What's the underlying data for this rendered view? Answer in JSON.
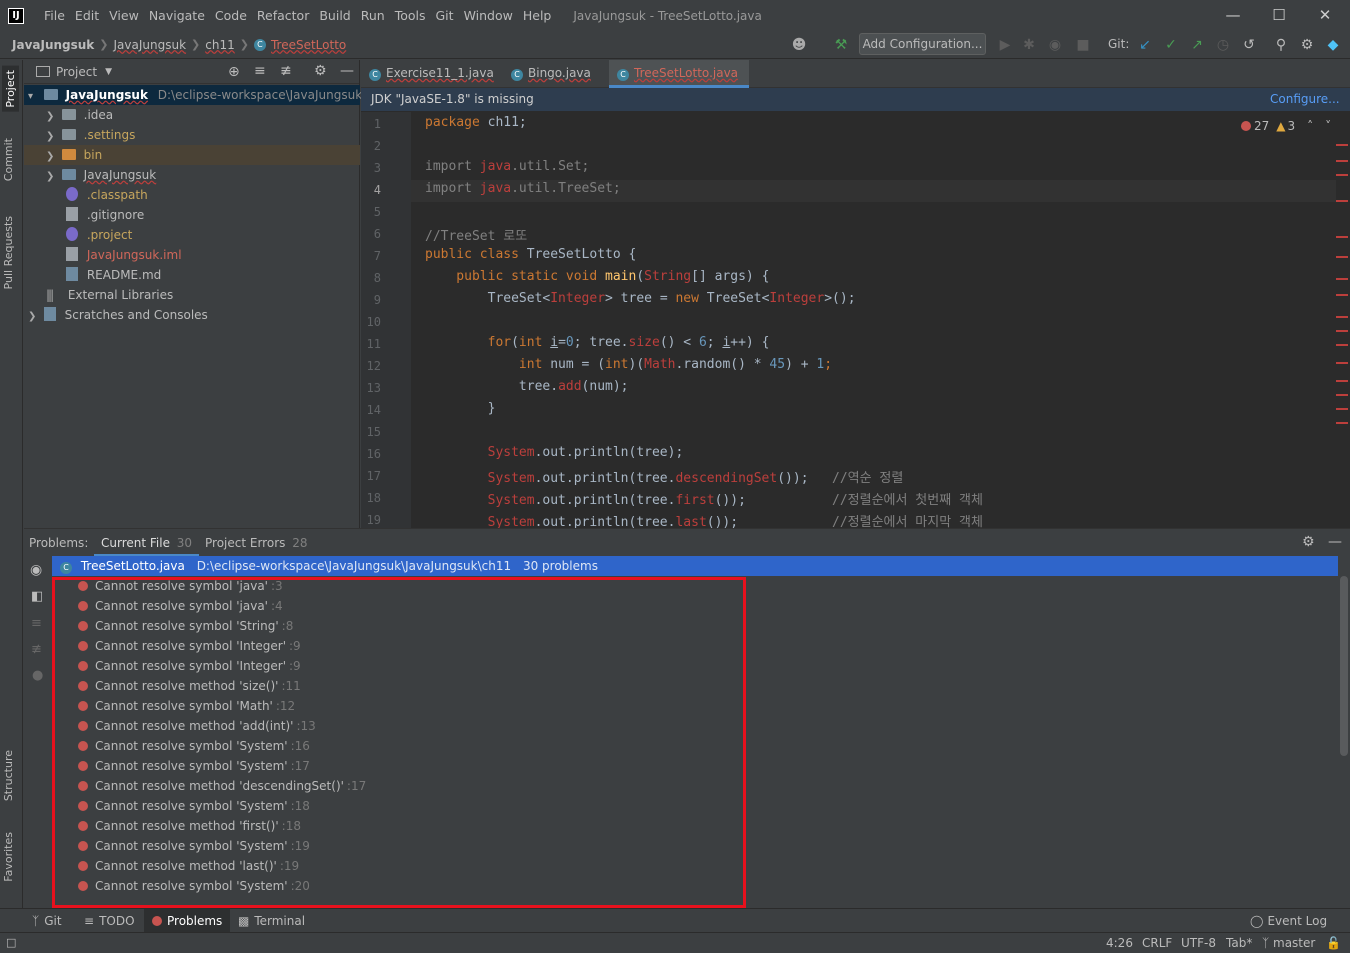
{
  "window": {
    "title": "JavaJungsuk - TreeSetLotto.java",
    "menu": [
      "File",
      "Edit",
      "View",
      "Navigate",
      "Code",
      "Refactor",
      "Build",
      "Run",
      "Tools",
      "Git",
      "Window",
      "Help"
    ],
    "logo": "IJ"
  },
  "breadcrumb": [
    "JavaJungsuk",
    "JavaJungsuk",
    "ch11",
    "TreeSetLotto"
  ],
  "toolbar": {
    "add_config": "Add Configuration...",
    "git_label": "Git:"
  },
  "left_stripe": {
    "project": "Project",
    "commit": "Commit",
    "pull_requests": "Pull Requests",
    "structure": "Structure",
    "favorites": "Favorites"
  },
  "project_panel": {
    "title": "Project",
    "root": {
      "name": "JavaJungsuk",
      "path": "D:\\eclipse-workspace\\JavaJungsuk"
    },
    "items": [
      {
        "name": ".idea",
        "type": "folder",
        "color": "#bbbbbb"
      },
      {
        "name": ".settings",
        "type": "folder",
        "color": "#c7a65d"
      },
      {
        "name": "bin",
        "type": "folder-excluded",
        "color": "#c7a65d"
      },
      {
        "name": "JavaJungsuk",
        "type": "folder",
        "color": "#bbbbbb"
      },
      {
        "name": ".classpath",
        "type": "file",
        "color": "#c7a65d"
      },
      {
        "name": ".gitignore",
        "type": "file",
        "color": "#bbbbbb"
      },
      {
        "name": ".project",
        "type": "file",
        "color": "#c7a65d"
      },
      {
        "name": "JavaJungsuk.iml",
        "type": "file",
        "color": "#d1675a"
      },
      {
        "name": "README.md",
        "type": "file",
        "color": "#bbbbbb"
      },
      {
        "name": "External Libraries",
        "type": "lib",
        "color": "#bbbbbb"
      },
      {
        "name": "Scratches and Consoles",
        "type": "scratch",
        "color": "#bbbbbb"
      }
    ]
  },
  "editor": {
    "tabs": [
      "Exercise11_1.java",
      "Bingo.java",
      "TreeSetLotto.java"
    ],
    "banner": {
      "message": "JDK \"JavaSE-1.8\" is missing",
      "action": "Configure..."
    },
    "inspection": {
      "errors": "27",
      "warnings": "3"
    },
    "line_numbers": [
      "1",
      "2",
      "3",
      "4",
      "5",
      "6",
      "7",
      "8",
      "9",
      "10",
      "11",
      "12",
      "13",
      "14",
      "15",
      "16",
      "17",
      "18",
      "19"
    ],
    "lines": {
      "l1": "package ch11;",
      "l3_a": "import ",
      "l3_b": "java",
      "l3_c": ".util.Set;",
      "l4_a": "import ",
      "l4_b": "java",
      "l4_c": ".util.TreeSet;",
      "l6": "//TreeSet 로또",
      "l7_a": "public class ",
      "l7_b": "TreeSetLotto {",
      "l8_a": "    public static void ",
      "l8_b": "main",
      "l8_c": "(",
      "l8_d": "String",
      "l8_e": "[] args) {",
      "l9_a": "        TreeSet<",
      "l9_b": "Integer",
      "l9_c": "> tree = ",
      "l9_d": "new ",
      "l9_e": "TreeSet<",
      "l9_f": "Integer",
      "l9_g": ">();",
      "l11_a": "        for",
      "l11_b": "(",
      "l11_c": "int ",
      "l11_d": "i",
      "l11_e": "=",
      "l11_f": "0",
      "l11_g": "; tree.",
      "l11_h": "size",
      "l11_i": "() < ",
      "l11_j": "6",
      "l11_k": "; ",
      "l11_l": "i",
      "l11_m": "++) {",
      "l12_a": "            int ",
      "l12_b": "num = (",
      "l12_c": "int",
      "l12_d": ")(",
      "l12_e": "Math",
      "l12_f": ".random() * ",
      "l12_g": "45",
      "l12_h": ") + ",
      "l12_i": "1",
      "l12_j": ";",
      "l13_a": "            tree.",
      "l13_b": "add",
      "l13_c": "(num);",
      "l14": "        }",
      "l16_a": "        System",
      "l16_b": ".out.println(tree);",
      "l17_a": "        System",
      "l17_b": ".out.println(tree.",
      "l17_c": "descendingSet",
      "l17_d": "());   ",
      "l17_e": "//역순 정렬",
      "l18_a": "        System",
      "l18_b": ".out.println(tree.",
      "l18_c": "first",
      "l18_d": "());           ",
      "l18_e": "//정렬순에서 첫번째 객체",
      "l19_a": "        System",
      "l19_b": ".out.println(tree.",
      "l19_c": "last",
      "l19_d": "());            ",
      "l19_e": "//정렬순에서 마지막 객체"
    }
  },
  "problems": {
    "label": "Problems:",
    "tabs": [
      {
        "name": "Current File",
        "count": "30"
      },
      {
        "name": "Project Errors",
        "count": "28"
      }
    ],
    "file": {
      "name": "TreeSetLotto.java",
      "path": "D:\\eclipse-workspace\\JavaJungsuk\\JavaJungsuk\\ch11",
      "summary": "30 problems"
    },
    "items": [
      {
        "message": "Cannot resolve symbol 'java'",
        "line": ":3"
      },
      {
        "message": "Cannot resolve symbol 'java'",
        "line": ":4"
      },
      {
        "message": "Cannot resolve symbol 'String'",
        "line": ":8"
      },
      {
        "message": "Cannot resolve symbol 'Integer'",
        "line": ":9"
      },
      {
        "message": "Cannot resolve symbol 'Integer'",
        "line": ":9"
      },
      {
        "message": "Cannot resolve method 'size()'",
        "line": ":11"
      },
      {
        "message": "Cannot resolve symbol 'Math'",
        "line": ":12"
      },
      {
        "message": "Cannot resolve method 'add(int)'",
        "line": ":13"
      },
      {
        "message": "Cannot resolve symbol 'System'",
        "line": ":16"
      },
      {
        "message": "Cannot resolve symbol 'System'",
        "line": ":17"
      },
      {
        "message": "Cannot resolve method 'descendingSet()'",
        "line": ":17"
      },
      {
        "message": "Cannot resolve symbol 'System'",
        "line": ":18"
      },
      {
        "message": "Cannot resolve method 'first()'",
        "line": ":18"
      },
      {
        "message": "Cannot resolve symbol 'System'",
        "line": ":19"
      },
      {
        "message": "Cannot resolve method 'last()'",
        "line": ":19"
      },
      {
        "message": "Cannot resolve symbol 'System'",
        "line": ":20"
      }
    ]
  },
  "bottom_tabs": [
    "Git",
    "TODO",
    "Problems",
    "Terminal",
    "Event Log"
  ],
  "status": {
    "position": "4:26",
    "line_sep": "CRLF",
    "encoding": "UTF-8",
    "indent": "Tab*",
    "branch": "master"
  },
  "colors": {
    "error": "#c75450",
    "selection": "#2f65ca",
    "highlight_box": "#e8111d",
    "accent_green": "#499c54"
  }
}
